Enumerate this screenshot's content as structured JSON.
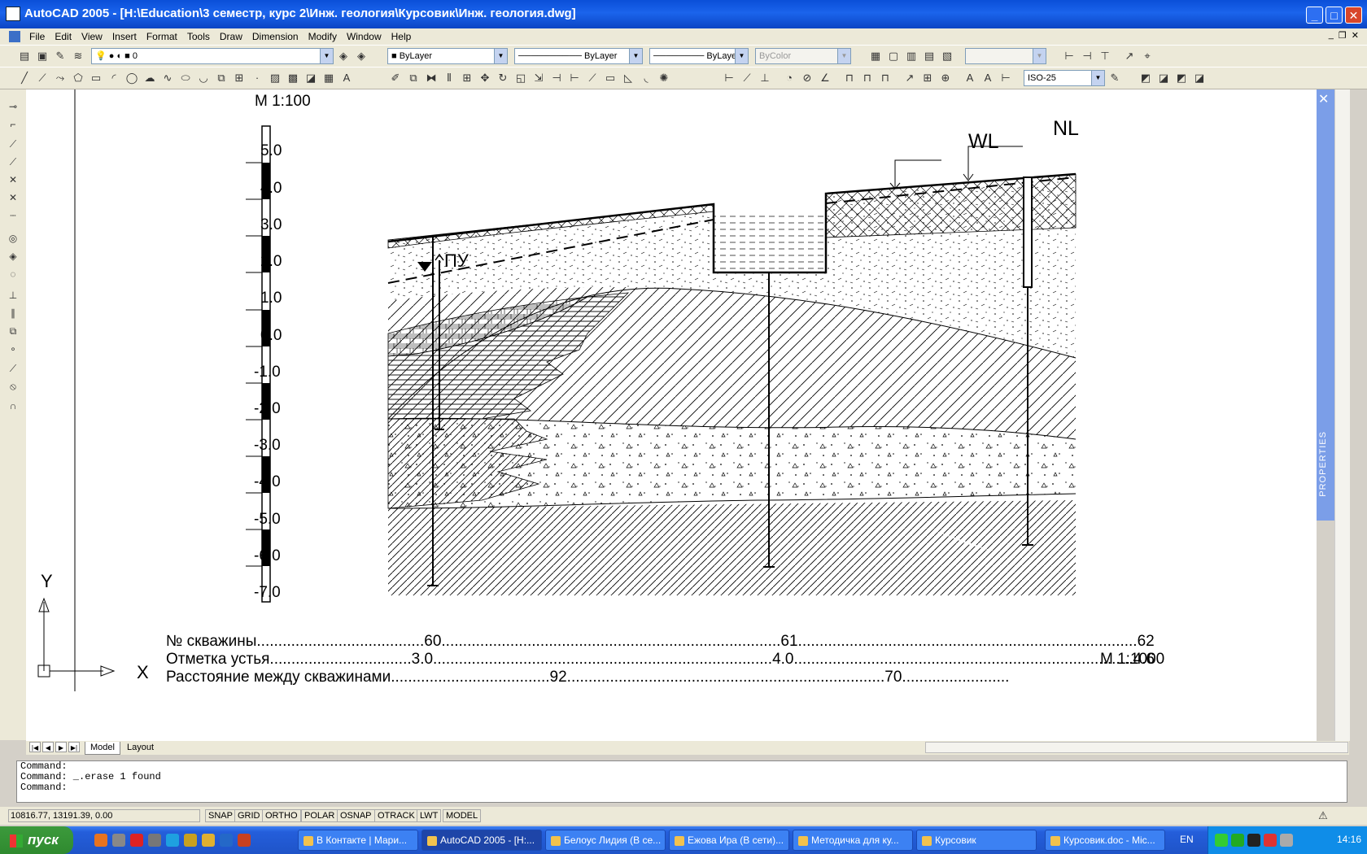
{
  "window": {
    "title": "AutoCAD 2005 - [H:\\Education\\3 семестр, курс 2\\Инж. геология\\Курсовик\\Инж. геология.dwg]"
  },
  "menu": [
    "File",
    "Edit",
    "View",
    "Insert",
    "Format",
    "Tools",
    "Draw",
    "Dimension",
    "Modify",
    "Window",
    "Help"
  ],
  "toolbar": {
    "layer": "0",
    "color": "ByLayer",
    "linetype": "ByLayer",
    "lineweight": "ByLayer",
    "plotstyle": "ByColor",
    "dimstyle": "ISO-25"
  },
  "drawing": {
    "scale_vertical": "M 1:100",
    "scale_horizontal": "M 1:1000",
    "ruler_labels": [
      "5.0",
      "4.0",
      "3.0",
      "2.0",
      "1.0",
      "0.0",
      "-1.0",
      "-2.0",
      "-3.0",
      "-4.0",
      "-5.0",
      "-6.0",
      "-7.0"
    ],
    "label_wl": "WL",
    "label_nl": "NL",
    "label_pu": "ПУ",
    "ucs_x": "X",
    "ucs_y": "Y",
    "table": {
      "row1": "№ скважины.......................................60...............................................................................61...............................................................................62",
      "row2": "Отметка устья.................................3.0...............................................................................4.0...............................................................................4.6",
      "row3": "Расстояние между скважинами.....................................92..........................................................................70........................."
    }
  },
  "properties_panel": {
    "label": "PROPERTIES"
  },
  "tabs": [
    "Model",
    "Layout"
  ],
  "command_lines": [
    "Command:",
    "Command: _.erase 1 found",
    "Command:"
  ],
  "status": {
    "coords": "10816.77, 13191.39, 0.00",
    "toggles": [
      "SNAP",
      "GRID",
      "ORTHO",
      "POLAR",
      "OSNAP",
      "OTRACK",
      "LWT",
      "MODEL"
    ]
  },
  "taskbar": {
    "start": "пуск",
    "tasks": [
      "В Контакте | Мари...",
      "AutoCAD 2005 - [H:...",
      "Белоус Лидия (В се...",
      "Ежова Ира (В сети)...",
      "Методичка для ку...",
      "Курсовик",
      "Курсовик.doc - Mic..."
    ],
    "lang": "EN",
    "clock": "14:16"
  }
}
